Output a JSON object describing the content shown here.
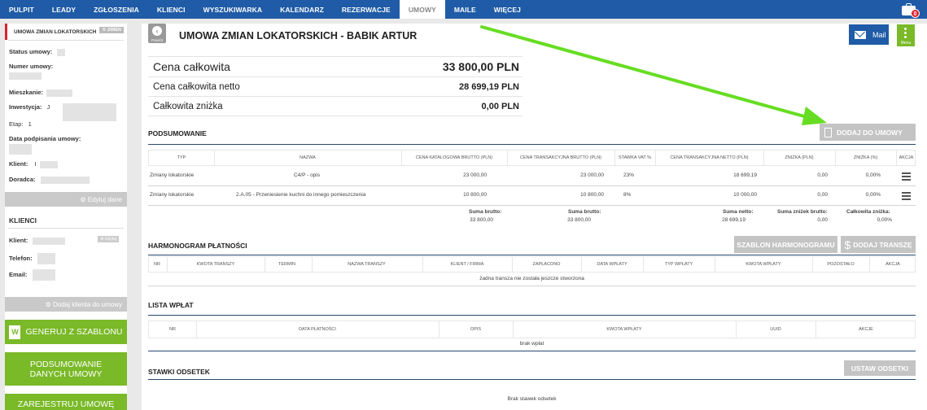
{
  "nav": {
    "items": [
      "PULPIT",
      "LEADY",
      "ZGŁOSZENIA",
      "KLIENCI",
      "WYSZUKIWARKA",
      "KALENDARZ",
      "REZERWACJE",
      "UMOWY",
      "MAILE",
      "WIĘCEJ"
    ],
    "active_index": 7,
    "notification_count": "0"
  },
  "sidebar": {
    "title": "UMOWA ZMIAN LOKATORSKICH",
    "badge": "ZMIEN",
    "fields": {
      "status": "Status umowy:",
      "number": "Numer umowy:",
      "apartment": "Mieszkanie:",
      "investment": "Inwestycja:",
      "investment_value": "J",
      "stage": "Etap:",
      "stage_value": "1",
      "sign_date": "Data podpisania umowy:",
      "client": "Klient:",
      "client_value": "I",
      "advisor": "Doradca:"
    },
    "edit_button": "Edytuj dane",
    "clients_title": "KLIENCI",
    "client_fields": {
      "client": "Klient:",
      "edit_badge": "Edytuj",
      "phone": "Telefon:",
      "email": "Email:"
    },
    "add_client_button": "Dodaj klienta do umowy",
    "generate_button": "GENERUJ Z SZABLONU",
    "summary_button": "PODSUMOWANIE DANYCH UMOWY",
    "register_button": "ZAREJESTRUJ UMOWĘ"
  },
  "main": {
    "back_label": "Powrót",
    "title": "UMOWA ZMIAN LOKATORSKICH - BABIK ARTUR",
    "mail_button": "Mail",
    "menu_label": "Menu",
    "prices": [
      {
        "label": "Cena całkowita",
        "value": "33 800,00 PLN"
      },
      {
        "label": "Cena całkowita netto",
        "value": "28 699,19 PLN"
      },
      {
        "label": "Całkowita zniżka",
        "value": "0,00 PLN"
      }
    ],
    "summary": {
      "title": "PODSUMOWANIE",
      "add_button": "DODAJ DO UMOWY",
      "headers": [
        "TYP",
        "NAZWA",
        "CENA KATALOGOWA BRUTTO (PLN)",
        "CENA TRANSAKCYJNA BRUTTO (PLN)",
        "STAWKA VAT %",
        "CENA TRANSAKCYJNA NETTO (PLN)",
        "ZNIŻKA (PLN)",
        "ZNIŻKA (%)",
        "AKCJA"
      ],
      "rows": [
        {
          "type": "Zmiany lokatorskie",
          "name": "C4/P - opis",
          "catalog": "23 000,00",
          "transaction": "23 000,00",
          "vat": "23%",
          "net": "18 699,19",
          "discount": "0,00",
          "discount_pct": "0,00%"
        },
        {
          "type": "Zmiany lokatorskie",
          "name": "2.A.05 - Przeniesienie kuchni do innego pomieszczenia",
          "catalog": "10 800,00",
          "transaction": "10 800,00",
          "vat": "8%",
          "net": "10 000,00",
          "discount": "0,00",
          "discount_pct": "0,00%"
        }
      ],
      "totals": {
        "gross_label": "Suma brutto:",
        "gross_value": "33 800,00",
        "gross2_label": "Suma brutto:",
        "gross2_value": "33 800,00",
        "net_label": "Suma netto:",
        "net_value": "28 699,19",
        "discounts_label": "Suma zniżek brutto:",
        "discounts_value": "0,00",
        "total_discount_label": "Całkowita zniżka:",
        "total_discount_value": "0,00%"
      }
    },
    "schedule": {
      "title": "HARMONOGRAM PŁATNOŚCI",
      "template_button": "SZABLON HARMONOGRAMU",
      "add_button": "DODAJ TRANSZĘ",
      "headers": [
        "NR",
        "KWOTA TRANSZY",
        "TERMIN",
        "NAZWA TRANSZY",
        "KLIENT / FIRMA",
        "ZAPŁACONO",
        "DATA WPŁATY",
        "TYP WPŁATY",
        "KWOTA WPŁATY",
        "POZOSTAŁO",
        "AKCJA"
      ],
      "empty": "żadna transza nie została jeszcze stworzona"
    },
    "payments": {
      "title": "LISTA WPŁAT",
      "headers": [
        "NR",
        "DATA PŁATNOŚCI",
        "OPIS",
        "KWOTA WPŁATY",
        "UUID",
        "AKCJE"
      ],
      "empty": "brak wpłat"
    },
    "interest": {
      "title": "STAWKI ODSETEK",
      "button": "USTAW ODSETKI",
      "empty": "Brak stawek odsetek"
    }
  },
  "colors": {
    "nav_bg": "#1f5ba6",
    "green": "#7ab928",
    "red": "#d9232d",
    "gray_button": "#c4c4c4",
    "arrow": "#66dd22"
  }
}
